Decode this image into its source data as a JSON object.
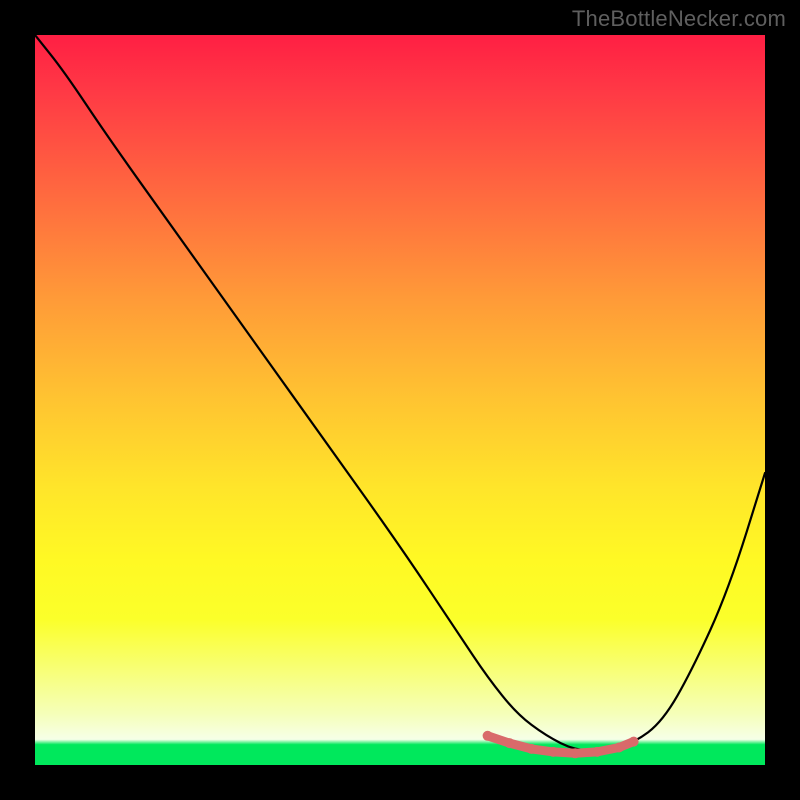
{
  "watermark": "TheBottleNecker.com",
  "chart_data": {
    "type": "line",
    "title": "",
    "xlabel": "",
    "ylabel": "",
    "xlim": [
      0,
      100
    ],
    "ylim": [
      0,
      100
    ],
    "grid": false,
    "series": [
      {
        "name": "bottleneck-curve",
        "color": "#000000",
        "x": [
          0,
          4,
          10,
          20,
          30,
          40,
          50,
          58,
          62,
          66,
          70,
          74,
          78,
          82,
          86,
          90,
          95,
          100
        ],
        "values": [
          100,
          95,
          86,
          72,
          58,
          44,
          30,
          18,
          12,
          7,
          4,
          2,
          2,
          3,
          6,
          13,
          24,
          40
        ]
      }
    ],
    "optimal_marker": {
      "color": "#d96a6a",
      "x": [
        62,
        65,
        68,
        71,
        74,
        77,
        80,
        82
      ],
      "values": [
        4.0,
        3.0,
        2.2,
        1.8,
        1.6,
        1.8,
        2.4,
        3.2
      ]
    },
    "background_gradient": {
      "top": "#ff1f44",
      "mid_upper": "#ff9a38",
      "mid": "#fff924",
      "mid_lower": "#f5ffb9",
      "bottom": "#00e85c"
    }
  }
}
